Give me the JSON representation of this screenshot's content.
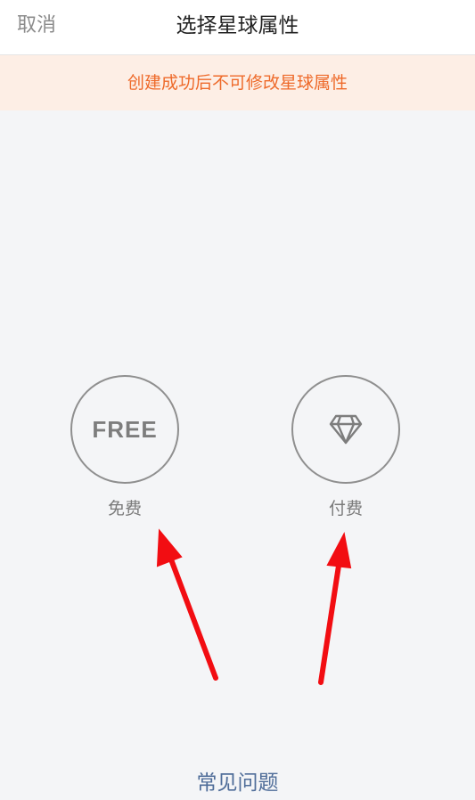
{
  "nav": {
    "cancel_label": "取消",
    "title": "选择星球属性"
  },
  "notice": {
    "text": "创建成功后不可修改星球属性",
    "color": "#ee6a2a",
    "background": "#fdeee5"
  },
  "options": [
    {
      "icon": "free-badge-icon",
      "icon_text": "FREE",
      "label": "免费"
    },
    {
      "icon": "diamond-icon",
      "label": "付费"
    }
  ],
  "faq": {
    "label": "常见问题",
    "color": "#4f6d99"
  },
  "annotation": {
    "arrow_color": "#f20d12"
  }
}
